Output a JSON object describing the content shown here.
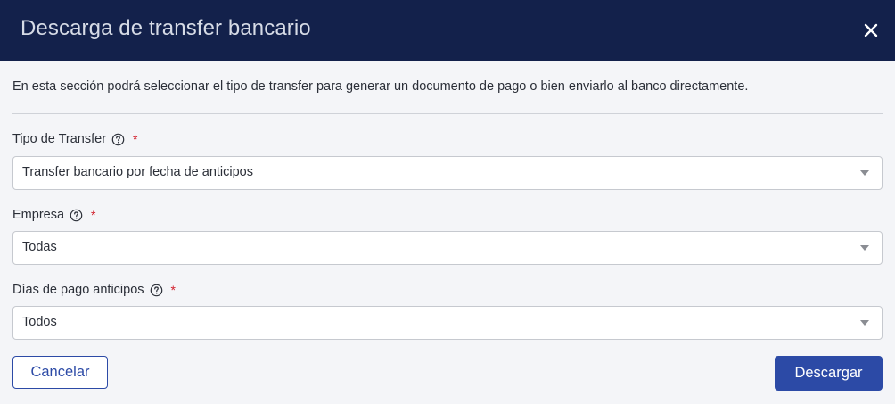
{
  "dialog": {
    "title": "Descarga de transfer bancario",
    "description": "En esta sección podrá seleccionar el tipo de transfer para generar un documento de pago o bien enviarlo al banco directamente."
  },
  "fields": [
    {
      "label": "Tipo de Transfer",
      "required_mark": "*",
      "value": "Transfer bancario por fecha de anticipos"
    },
    {
      "label": "Empresa",
      "required_mark": "*",
      "value": "Todas"
    },
    {
      "label": "Días de pago anticipos",
      "required_mark": "*",
      "value": "Todos"
    }
  ],
  "actions": {
    "cancel_label": "Cancelar",
    "download_label": "Descargar"
  },
  "icons": {
    "close": "close-icon",
    "help": "help-circle-icon",
    "dropdown": "caret-down-icon"
  },
  "colors": {
    "header_bg": "#13214b",
    "primary": "#2c4aa6",
    "required": "#d11d2a",
    "background": "#f4f5f8"
  }
}
